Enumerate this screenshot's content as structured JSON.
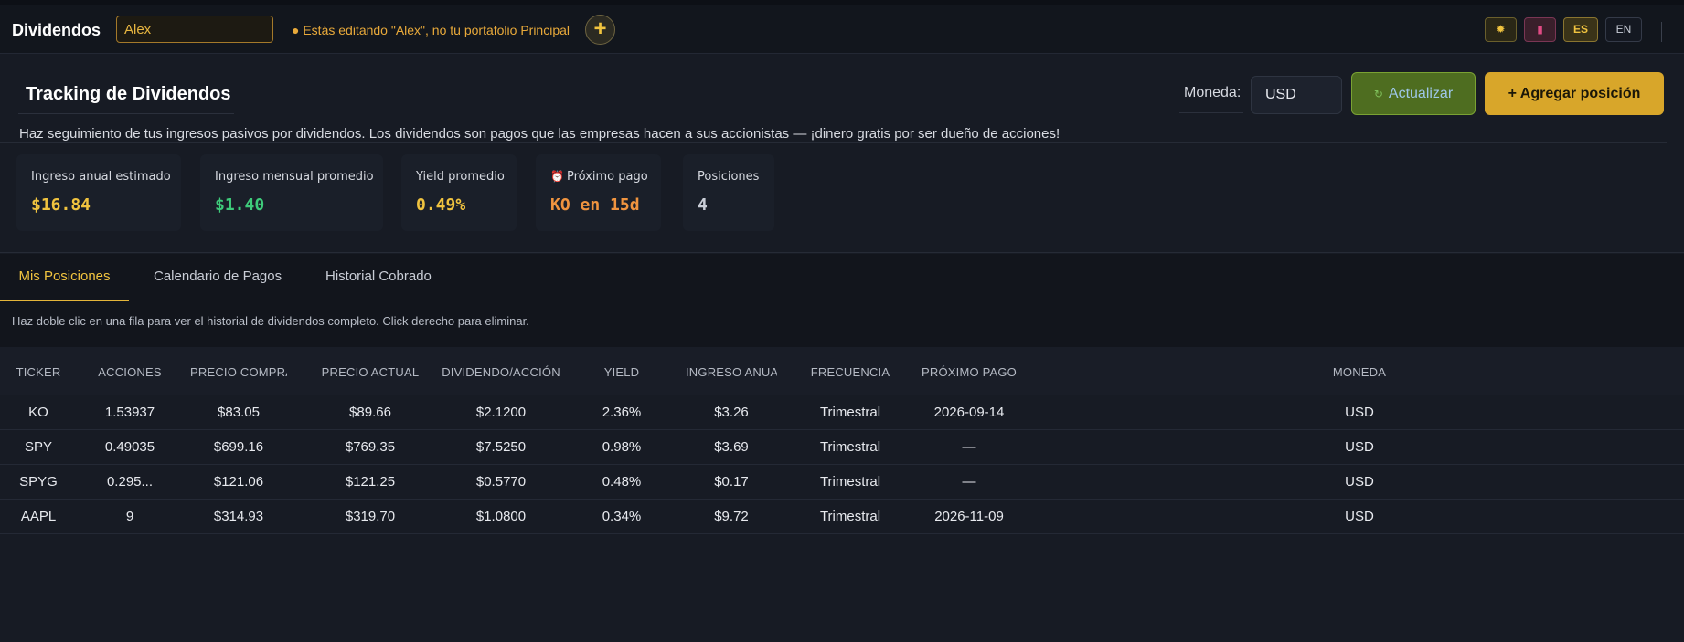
{
  "topbar": {
    "app_title": "Dividendos",
    "portfolio_name": "Alex",
    "edit_warning": "● Estás editando \"Alex\", no tu portafolio Principal",
    "add_portfolio_symbol": "+",
    "theme_icon": "sun-icon",
    "lang_es": "ES",
    "lang_en": "EN"
  },
  "header": {
    "title": "Tracking de Dividendos",
    "currency_label": "Moneda:",
    "currency_value": "USD",
    "refresh_label": "Actualizar",
    "add_position_label": "+ Agregar posición",
    "description": "Haz seguimiento de tus ingresos pasivos por dividendos. Los dividendos son pagos que las empresas hacen a sus accionistas — ¡dinero gratis por ser dueño de acciones!"
  },
  "stats": [
    {
      "label": "Ingreso anual estimado",
      "value": "$16.84",
      "color": "#f0c33f"
    },
    {
      "label": "Ingreso mensual promedio",
      "value": "$1.40",
      "color": "#3ecb7a"
    },
    {
      "label": "Yield promedio",
      "value": "0.49%",
      "color": "#f0c33f"
    },
    {
      "label": "Próximo pago",
      "value": "KO en 15d",
      "color": "#f0943f"
    },
    {
      "label": "Posiciones",
      "value": "4",
      "color": "#c9cdd6"
    }
  ],
  "tabs": [
    {
      "label": "Mis Posiciones",
      "active": true
    },
    {
      "label": "Calendario de Pagos",
      "active": false
    },
    {
      "label": "Historial Cobrado",
      "active": false
    }
  ],
  "hint": "Haz doble clic en una fila para ver el historial de dividendos completo. Click derecho para eliminar.",
  "table": {
    "columns": [
      "TICKER",
      "ACCIONES",
      "PRECIO COMPRA",
      "PRECIO ACTUAL",
      "DIVIDENDO/ACCIÓN",
      "YIELD",
      "INGRESO ANUAL",
      "FRECUENCIA",
      "PRÓXIMO PAGO",
      "MONEDA"
    ],
    "rows": [
      [
        "KO",
        "1.53937",
        "$83.05",
        "$89.66",
        "$2.1200",
        "2.36%",
        "$3.26",
        "Trimestral",
        "2026-09-14",
        "USD"
      ],
      [
        "SPY",
        "0.49035",
        "$699.16",
        "$769.35",
        "$7.5250",
        "0.98%",
        "$3.69",
        "Trimestral",
        "—",
        "USD"
      ],
      [
        "SPYG",
        "0.295...",
        "$121.06",
        "$121.25",
        "$0.5770",
        "0.48%",
        "$0.17",
        "Trimestral",
        "—",
        "USD"
      ],
      [
        "AAPL",
        "9",
        "$314.93",
        "$319.70",
        "$1.0800",
        "0.34%",
        "$9.72",
        "Trimestral",
        "2026-11-09",
        "USD"
      ]
    ]
  }
}
